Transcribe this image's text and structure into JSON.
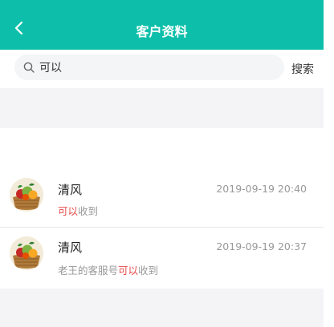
{
  "header": {
    "title": "客户资料",
    "back_icon": "chevron-left-icon",
    "bg_color": "#0dbfaa"
  },
  "search": {
    "value": "可以",
    "icon": "search-icon",
    "button_label": "搜索"
  },
  "results": [
    {
      "name": "清风",
      "time": "2019-09-19 20:40",
      "message_prefix": "",
      "message_highlight": "可以",
      "message_suffix": "收到",
      "avatar": "fruit-basket-avatar"
    },
    {
      "name": "清风",
      "time": "2019-09-19 20:37",
      "message_prefix": "老王的客服号",
      "message_highlight": "可以",
      "message_suffix": "收到",
      "avatar": "fruit-basket-avatar"
    }
  ],
  "colors": {
    "accent": "#0dbfaa",
    "highlight": "#e84b4b",
    "muted_text": "#999999",
    "page_bg": "#f4f4f6"
  }
}
